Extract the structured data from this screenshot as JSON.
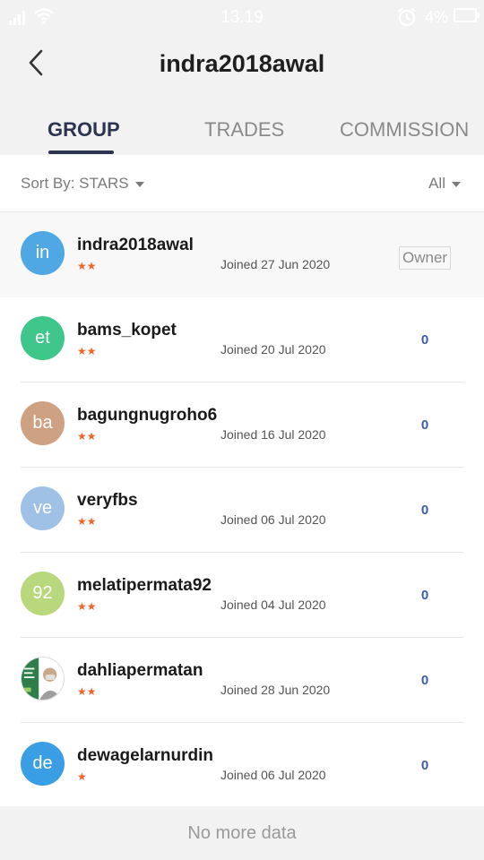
{
  "status_bar": {
    "time": "13.19",
    "battery": "4%",
    "icons": [
      "signal-icon",
      "wifi-icon",
      "alarm-icon",
      "battery-icon"
    ]
  },
  "header": {
    "title": "indra2018awal",
    "back_icon": "chevron-left-icon"
  },
  "tabs": [
    {
      "label": "GROUP",
      "active": true
    },
    {
      "label": "TRADES",
      "active": false
    },
    {
      "label": "COMMISSION",
      "active": false
    }
  ],
  "sort": {
    "label": "Sort By: STARS",
    "filter": "All"
  },
  "members": [
    {
      "initials": "in",
      "name": "indra2018awal",
      "stars": "★★",
      "joined": "Joined 27 Jun 2020",
      "badge": "Owner",
      "commission": "",
      "color": "#4fa7e3"
    },
    {
      "initials": "et",
      "name": "bams_kopet",
      "stars": "★★",
      "joined": "Joined 20 Jul 2020",
      "badge": "",
      "commission": "0",
      "color": "#3fc68a"
    },
    {
      "initials": "ba",
      "name": "bagungnugroho6",
      "stars": "★★",
      "joined": "Joined 16 Jul 2020",
      "badge": "",
      "commission": "0",
      "color": "#cfa183"
    },
    {
      "initials": "ve",
      "name": "veryfbs",
      "stars": "★★",
      "joined": "Joined 06 Jul 2020",
      "badge": "",
      "commission": "0",
      "color": "#9fc1e6"
    },
    {
      "initials": "92",
      "name": "melatipermata92",
      "stars": "★★",
      "joined": "Joined 04 Jul 2020",
      "badge": "",
      "commission": "0",
      "color": "#b9d77c"
    },
    {
      "initials": "",
      "name": "dahliapermatan",
      "stars": "★★",
      "joined": "Joined 28 Jun 2020",
      "badge": "",
      "commission": "0",
      "color": "#2e7d4a"
    },
    {
      "initials": "de",
      "name": "dewagelarnurdin",
      "stars": "★",
      "joined": "Joined 06 Jul 2020",
      "badge": "",
      "commission": "0",
      "color": "#3a9ee4"
    }
  ],
  "footer": {
    "text": "No more data"
  }
}
